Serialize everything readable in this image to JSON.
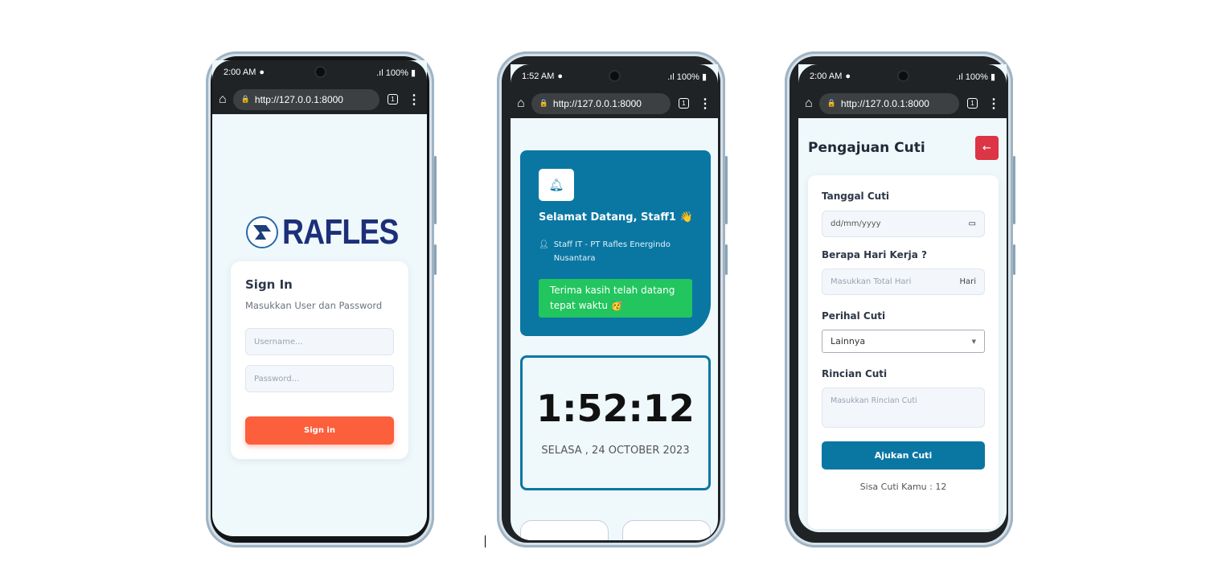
{
  "phones": [
    {
      "status": {
        "time": "2:00 AM",
        "battery": "100%"
      },
      "browser": {
        "url": "http://127.0.0.1:8000",
        "tab_count": "1"
      }
    },
    {
      "status": {
        "time": "1:52 AM",
        "battery": "100%"
      },
      "browser": {
        "url": "http://127.0.0.1:8000",
        "tab_count": "1"
      }
    },
    {
      "status": {
        "time": "2:00 AM",
        "battery": "100%"
      },
      "browser": {
        "url": "http://127.0.0.1:8000",
        "tab_count": "1"
      }
    }
  ],
  "login": {
    "logo_text": "RAFLES",
    "title": "Sign In",
    "subtitle": "Masukkan User dan Password",
    "username_placeholder": "Username...",
    "password_placeholder": "Password...",
    "signin_label": "Sign in",
    "accent": "#fc5f3b"
  },
  "dashboard": {
    "greeting": "Selamat Datang, Staff1 👋",
    "role": "Staff IT - PT Rafles Energindo Nusantara",
    "alert": "Terima kasih telah datang tepat waktu 🥳",
    "clock": "1:52:12",
    "date": "SELASA , 24 OCTOBER 2023",
    "brand_color": "#0a77a3",
    "success_color": "#22c55e"
  },
  "leave": {
    "title": "Pengajuan Cuti",
    "date_label": "Tanggal Cuti",
    "date_placeholder": "dd/mm/yyyy",
    "days_label": "Berapa Hari Kerja ?",
    "days_placeholder": "Masukkan Total Hari",
    "days_suffix": "Hari",
    "reason_label": "Perihal Cuti",
    "reason_value": "Lainnya",
    "detail_label": "Rincian Cuti",
    "detail_placeholder": "Masukkan Rincian Cuti",
    "submit_label": "Ajukan Cuti",
    "remaining": "Sisa Cuti Kamu : 12",
    "back_color": "#dc3545"
  }
}
